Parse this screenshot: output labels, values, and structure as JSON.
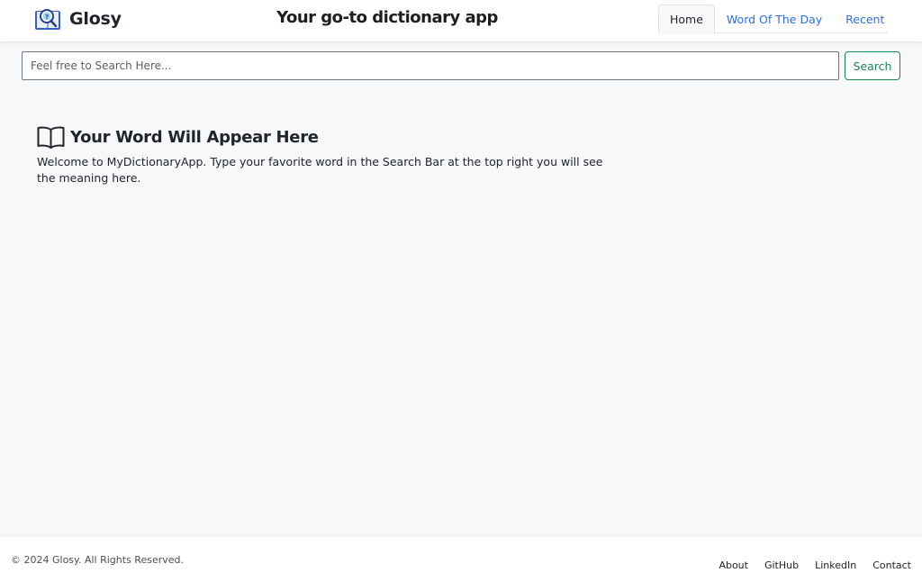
{
  "header": {
    "brand_name": "Glosy",
    "tagline": "Your go-to dictionary app",
    "tabs": [
      {
        "label": "Home",
        "active": true
      },
      {
        "label": "Word Of The Day",
        "active": false
      },
      {
        "label": "Recent",
        "active": false
      }
    ]
  },
  "search": {
    "placeholder": "Feel free to Search Here...",
    "value": "",
    "button_label": "Search"
  },
  "main": {
    "title": "Your Word Will Appear Here",
    "description": "Welcome to MyDictionaryApp. Type your favorite word in the Search Bar at the top right you will see the meaning here."
  },
  "footer": {
    "copyright": "© 2024 Glosy. All Rights Reserved.",
    "links": [
      "About",
      "GitHub",
      "LinkedIn",
      "Contact"
    ]
  },
  "icons": {
    "logo": "dictionary-search-logo-icon",
    "title": "open-book-icon"
  },
  "colors": {
    "link": "#2f6fe0",
    "search_button": "#198754",
    "background": "#f7f8fa"
  }
}
